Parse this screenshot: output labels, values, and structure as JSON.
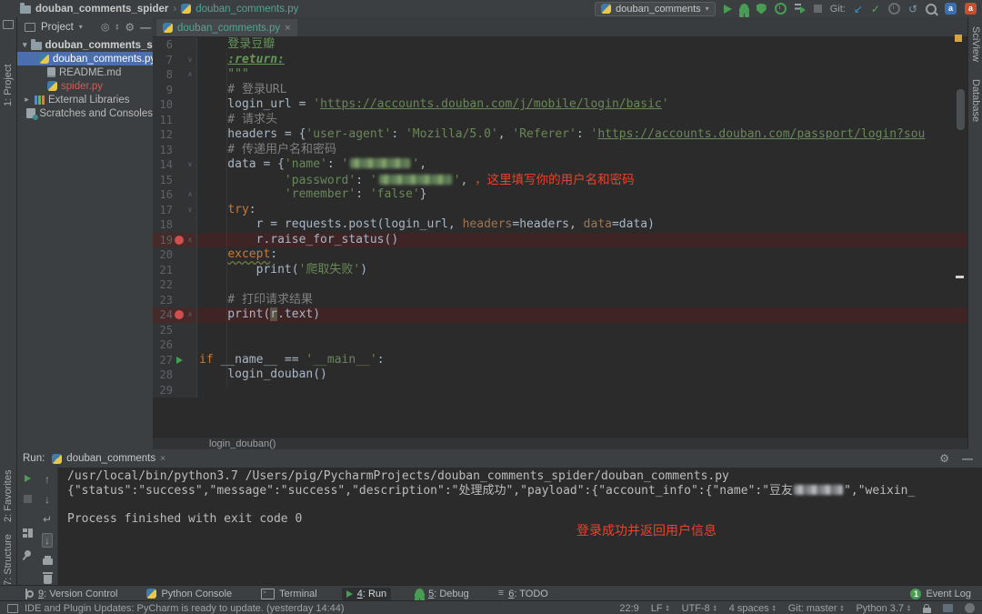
{
  "colors": {
    "panel_bg": "#3c3f41",
    "editor_bg": "#2b2b2b",
    "selection_blue": "#4b6eaf",
    "keyword_orange": "#cc7832",
    "string_green": "#6a8759",
    "comment_gray": "#808080",
    "doc_green": "#629755",
    "annotation_red": "#e8432d",
    "breakpoint_line_bg": "#3e2424",
    "breakpoint_dot": "#cf4f4f",
    "run_green": "#499c54",
    "tab_accent_teal": "#3f7a72",
    "vcs_added_teal": "#56a293",
    "vcs_unversioned_red": "#cf5b56",
    "line_number_gray": "#606366",
    "git_blue": "#3592c4"
  },
  "title_bar": {
    "project": "douban_comments_spider",
    "separator": "›",
    "file": "douban_comments.py",
    "run_config": "douban_comments",
    "git_label": "Git:"
  },
  "left_strip": {
    "project": "1: Project",
    "favorites": "2: Favorites",
    "structure": "7: Structure"
  },
  "right_strip": {
    "sciview": "SciView",
    "database": "Database"
  },
  "project_panel": {
    "header": "Project",
    "tree": [
      {
        "label": "douban_comments_spider",
        "icon": "folder",
        "chevron": "down",
        "indent": 0,
        "bold": true
      },
      {
        "label": "douban_comments.py",
        "icon": "python",
        "indent": 1,
        "selected": true
      },
      {
        "label": "README.md",
        "icon": "file",
        "indent": 1
      },
      {
        "label": "spider.py",
        "icon": "python",
        "indent": 1,
        "red": true
      },
      {
        "label": "External Libraries",
        "icon": "libs",
        "chevron": "right",
        "indent": 0
      },
      {
        "label": "Scratches and Consoles",
        "icon": "scratch",
        "indent": 0
      }
    ]
  },
  "editor": {
    "tab": "douban_comments.py",
    "breadcrumb": "login_douban()",
    "lines": [
      {
        "n": 6,
        "segs": [
          [
            "d",
            "    登录豆瓣"
          ]
        ]
      },
      {
        "n": 7,
        "fold": "v",
        "segs": [
          [
            "p",
            "    "
          ],
          [
            "dt",
            ":return:"
          ]
        ]
      },
      {
        "n": 8,
        "fold": "^",
        "segs": [
          [
            "d",
            "    \"\"\""
          ]
        ]
      },
      {
        "n": 9,
        "segs": [
          [
            "c",
            "    # 登录URL"
          ]
        ]
      },
      {
        "n": 10,
        "segs": [
          [
            "p",
            "    login_url = "
          ],
          [
            "s",
            "'"
          ],
          [
            "su",
            "https://accounts.douban.com/j/mobile/login/basic"
          ],
          [
            "s",
            "'"
          ]
        ]
      },
      {
        "n": 11,
        "segs": [
          [
            "c",
            "    # 请求头"
          ]
        ]
      },
      {
        "n": 12,
        "segs": [
          [
            "p",
            "    headers = {"
          ],
          [
            "s",
            "'user-agent'"
          ],
          [
            "p",
            ": "
          ],
          [
            "s",
            "'Mozilla/5.0'"
          ],
          [
            "p",
            ", "
          ],
          [
            "s",
            "'Referer'"
          ],
          [
            "p",
            ": "
          ],
          [
            "s",
            "'"
          ],
          [
            "su",
            "https://accounts.douban.com/passport/login?sou"
          ]
        ]
      },
      {
        "n": 13,
        "segs": [
          [
            "c",
            "    # 传递用户名和密码"
          ]
        ]
      },
      {
        "n": 14,
        "fold": "v",
        "segs": [
          [
            "p",
            "    data = {"
          ],
          [
            "s",
            "'name'"
          ],
          [
            "p",
            ": "
          ],
          [
            "s",
            "'"
          ],
          [
            "cen1",
            ""
          ],
          [
            "s",
            "'"
          ],
          [
            "p",
            ","
          ]
        ]
      },
      {
        "n": 15,
        "segs": [
          [
            "p",
            "            "
          ],
          [
            "s",
            "'password'"
          ],
          [
            "p",
            ": "
          ],
          [
            "s",
            "'"
          ],
          [
            "cen2",
            ""
          ],
          [
            "s",
            "'"
          ],
          [
            "p",
            ", "
          ],
          [
            "red",
            "，这里填写你的用户名和密码"
          ]
        ]
      },
      {
        "n": 16,
        "fold": "^",
        "segs": [
          [
            "p",
            "            "
          ],
          [
            "s",
            "'remember'"
          ],
          [
            "p",
            ": "
          ],
          [
            "s",
            "'false'"
          ],
          [
            "p",
            "}"
          ]
        ]
      },
      {
        "n": 17,
        "fold": "v",
        "segs": [
          [
            "p",
            "    "
          ],
          [
            "k",
            "try"
          ],
          [
            "p",
            ":"
          ]
        ]
      },
      {
        "n": 18,
        "segs": [
          [
            "p",
            "        r = requests.post(login_url, "
          ],
          [
            "pr",
            "headers"
          ],
          [
            "p",
            "=headers, "
          ],
          [
            "pr",
            "data"
          ],
          [
            "p",
            "=data)"
          ]
        ]
      },
      {
        "n": 19,
        "bp": true,
        "fold": "^",
        "segs": [
          [
            "p",
            "        r.raise_for_status()"
          ]
        ]
      },
      {
        "n": 20,
        "segs": [
          [
            "p",
            "    "
          ],
          [
            "ke",
            "except"
          ],
          [
            "p",
            ":"
          ]
        ]
      },
      {
        "n": 21,
        "segs": [
          [
            "p",
            "        print("
          ],
          [
            "s",
            "'爬取失败'"
          ],
          [
            "p",
            ")"
          ]
        ]
      },
      {
        "n": 22,
        "segs": []
      },
      {
        "n": 23,
        "segs": [
          [
            "c",
            "    # 打印请求结果"
          ]
        ]
      },
      {
        "n": 24,
        "bp": true,
        "fold": "^",
        "segs": [
          [
            "p",
            "    print("
          ],
          [
            "hl",
            "r"
          ],
          [
            "p",
            ".text)"
          ]
        ]
      },
      {
        "n": 25,
        "segs": []
      },
      {
        "n": 26,
        "segs": []
      },
      {
        "n": 27,
        "run": true,
        "segs": [
          [
            "k",
            "if"
          ],
          [
            "p",
            " __name__ == "
          ],
          [
            "s",
            "'__main__'"
          ],
          [
            "p",
            ":"
          ]
        ]
      },
      {
        "n": 28,
        "segs": [
          [
            "p",
            "    login_douban()"
          ]
        ]
      },
      {
        "n": 29,
        "segs": []
      }
    ]
  },
  "run_panel": {
    "label": "Run:",
    "tab": "douban_comments",
    "annotation": "登录成功并返回用户信息",
    "console": [
      {
        "segs": [
          [
            "t",
            "/usr/local/bin/python3.7 /Users/pig/PycharmProjects/douban_comments_spider/douban_comments.py"
          ]
        ]
      },
      {
        "segs": [
          [
            "t",
            "{\"status\":\"success\",\"message\":\"success\",\"description\":\"处理成功\",\"payload\":{\"account_info\":{\"name\":\"豆友"
          ],
          [
            "cen3",
            ""
          ],
          [
            "t",
            "\",\"weixin_"
          ]
        ]
      },
      {
        "segs": []
      },
      {
        "segs": [
          [
            "t",
            "Process finished with exit code 0"
          ]
        ]
      }
    ]
  },
  "bottom_bar": {
    "items": [
      {
        "key": "9",
        "label": "Version Control",
        "icon": "branch"
      },
      {
        "key": "",
        "label": "Python Console",
        "icon": "python"
      },
      {
        "key": "",
        "label": "Terminal",
        "icon": "terminal"
      },
      {
        "key": "4",
        "label": "Run",
        "icon": "run",
        "active": true
      },
      {
        "key": "5",
        "label": "Debug",
        "icon": "bug"
      },
      {
        "key": "6",
        "label": "TODO",
        "icon": "todo"
      }
    ],
    "event_log": {
      "count": "1",
      "label": "Event Log"
    }
  },
  "status_bar": {
    "message": "IDE and Plugin Updates: PyCharm is ready to update. (yesterday 14:44)",
    "right": [
      "22:9",
      "LF",
      "UTF-8",
      "4 spaces",
      "Git: master",
      "Python 3.7"
    ]
  }
}
